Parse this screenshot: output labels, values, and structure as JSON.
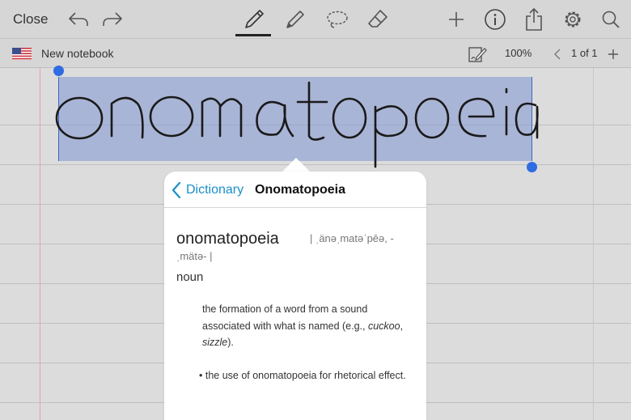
{
  "toolbar": {
    "close_label": "Close",
    "icons": [
      "undo-icon",
      "redo-icon",
      "pen-icon",
      "pencil-icon",
      "lasso-icon",
      "eraser-icon",
      "plus-icon",
      "info-icon",
      "share-icon",
      "gear-icon",
      "search-icon"
    ]
  },
  "subbar": {
    "flag": "us-flag-icon",
    "notebook_name": "New notebook",
    "zoom": "100%",
    "page_indicator": "1 of 1"
  },
  "canvas": {
    "handwritten_text": "onomatopoeia",
    "selection_color": "#8096d2",
    "handle_color": "#2f6be3"
  },
  "dictionary": {
    "back_label": "Dictionary",
    "title": "Onomatopoeia",
    "headword": "onomatopoeia",
    "pronunciation_1": "| ˌänəˌmatəˈpēə,   -",
    "pronunciation_2": "ˌmätə- |",
    "part_of_speech": "noun",
    "definition_1_pre": "the formation of a word from a sound associated with what is named (e.g., ",
    "definition_1_ex1": "cuckoo",
    "definition_1_sep": ", ",
    "definition_1_ex2": "sizzle",
    "definition_1_post": ").",
    "definition_2": "• the use of onomatopoeia for rhetorical effect.",
    "link_color": "#1a8fc8"
  }
}
